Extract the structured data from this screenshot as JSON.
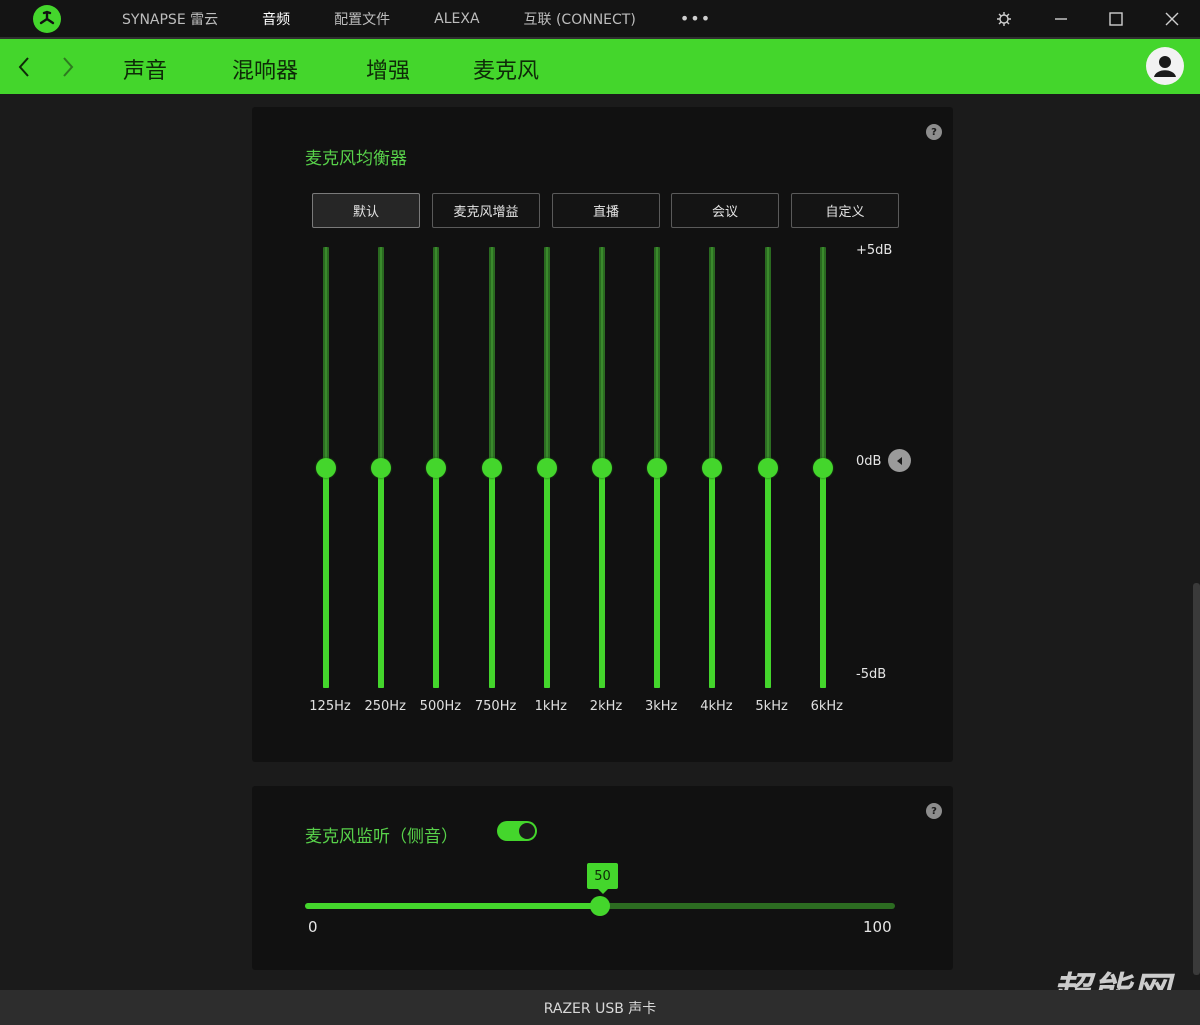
{
  "titlebar": {
    "nav": [
      "SYNAPSE 雷云",
      "音频",
      "配置文件",
      "ALEXA",
      "互联 (CONNECT)"
    ],
    "active_nav": "音频",
    "more": "•••"
  },
  "subnav": {
    "tabs": [
      "声音",
      "混响器",
      "增强",
      "麦克风"
    ],
    "active_tab": "麦克风"
  },
  "eq": {
    "title": "麦克风均衡器",
    "presets": [
      "默认",
      "麦克风增益",
      "直播",
      "会议",
      "自定义"
    ],
    "active_preset": "默认",
    "db_max": "+5dB",
    "db_zero": "0dB",
    "db_min": "-5dB",
    "bands": [
      {
        "freq": "125Hz",
        "gain_db": 0
      },
      {
        "freq": "250Hz",
        "gain_db": 0
      },
      {
        "freq": "500Hz",
        "gain_db": 0
      },
      {
        "freq": "750Hz",
        "gain_db": 0
      },
      {
        "freq": "1kHz",
        "gain_db": 0
      },
      {
        "freq": "2kHz",
        "gain_db": 0
      },
      {
        "freq": "3kHz",
        "gain_db": 0
      },
      {
        "freq": "4kHz",
        "gain_db": 0
      },
      {
        "freq": "5kHz",
        "gain_db": 0
      },
      {
        "freq": "6kHz",
        "gain_db": 0
      }
    ]
  },
  "sidetone": {
    "title": "麦克风监听（侧音）",
    "enabled": true,
    "value": "50",
    "min": "0",
    "max": "100"
  },
  "help_label": "?",
  "footer": {
    "device": "RAZER USB 声卡"
  },
  "watermark": "超能网",
  "colors": {
    "accent": "#44d62c",
    "panel": "#111111",
    "background": "#1b1b1b"
  }
}
